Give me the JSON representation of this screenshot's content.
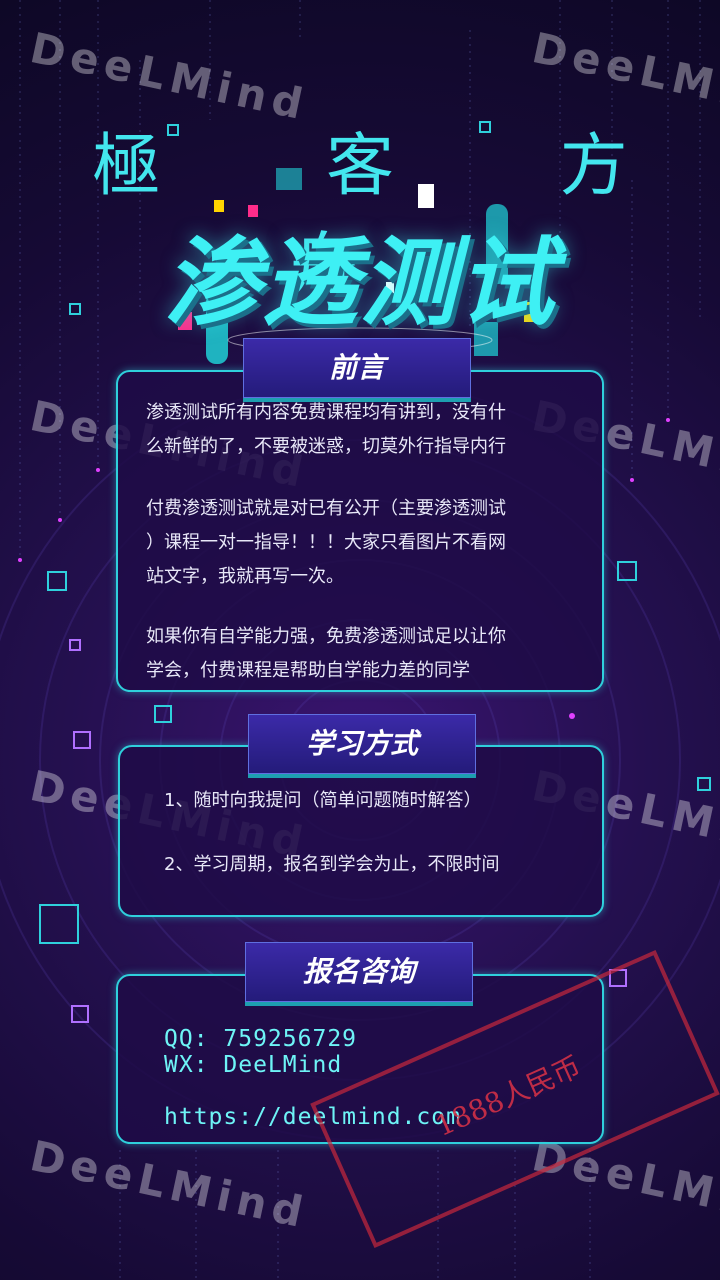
{
  "colors": {
    "accent": "#3ef0f4",
    "border": "#2fd0dc",
    "tag_bg": "#2d2190",
    "stamp": "#c8283c"
  },
  "watermark": "DeeLMind",
  "brand": "極 客 方 舟",
  "hero_title": "渗透测试",
  "sections": {
    "intro": {
      "title": "前言",
      "paragraphs": [
        [
          "渗透测试所有内容免费课程均有讲到，没有什",
          "么新鲜的了，不要被迷惑，切莫外行指导内行"
        ],
        [
          "付费渗透测试就是对已有公开（主要渗透测试",
          "）课程一对一指导！！！大家只看图片不看网",
          "站文字，我就再写一次。"
        ],
        [
          "如果你有自学能力强，免费渗透测试足以让你",
          "学会，付费课程是帮助自学能力差的同学"
        ]
      ]
    },
    "method": {
      "title": "学习方式",
      "items": [
        "1、随时向我提问（简单问题随时解答）",
        "2、学习周期，报名到学会为止，不限时间"
      ]
    },
    "contact": {
      "title": "报名咨询",
      "qq": "QQ: 759256729",
      "wx": "WX: DeeLMind",
      "url": "https://deelmind.com"
    }
  },
  "stamp": "1888人民币"
}
